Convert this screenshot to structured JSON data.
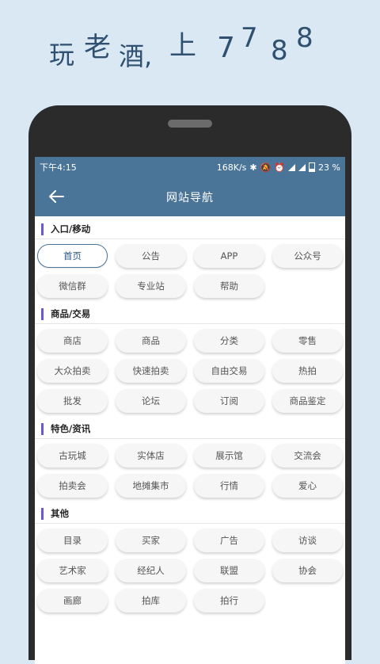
{
  "promo": {
    "chars": [
      "玩",
      "老",
      "酒,",
      "上",
      "7",
      "7",
      "8",
      "8"
    ]
  },
  "status": {
    "time": "下午4:15",
    "net_speed": "168K/s",
    "battery": "23 %"
  },
  "appbar": {
    "title": "网站导航"
  },
  "sections": [
    {
      "title": "入口/移动",
      "items": [
        "首页",
        "公告",
        "APP",
        "公众号",
        "微信群",
        "专业站",
        "帮助"
      ],
      "active_index": 0
    },
    {
      "title": "商品/交易",
      "items": [
        "商店",
        "商品",
        "分类",
        "零售",
        "大众拍卖",
        "快速拍卖",
        "自由交易",
        "热拍",
        "批发",
        "论坛",
        "订阅",
        "商品鉴定"
      ]
    },
    {
      "title": "特色/资讯",
      "items": [
        "古玩城",
        "实体店",
        "展示馆",
        "交流会",
        "拍卖会",
        "地摊集市",
        "行情",
        "爱心"
      ]
    },
    {
      "title": "其他",
      "items": [
        "目录",
        "买家",
        "广告",
        "访谈",
        "艺术家",
        "经纪人",
        "联盟",
        "协会",
        "画廊",
        "拍库",
        "拍行"
      ]
    }
  ],
  "colors": {
    "header": "#4a7599",
    "section_bar": "#6a5acd",
    "promo_text": "#2f5070",
    "background": "#d9e8f2"
  }
}
